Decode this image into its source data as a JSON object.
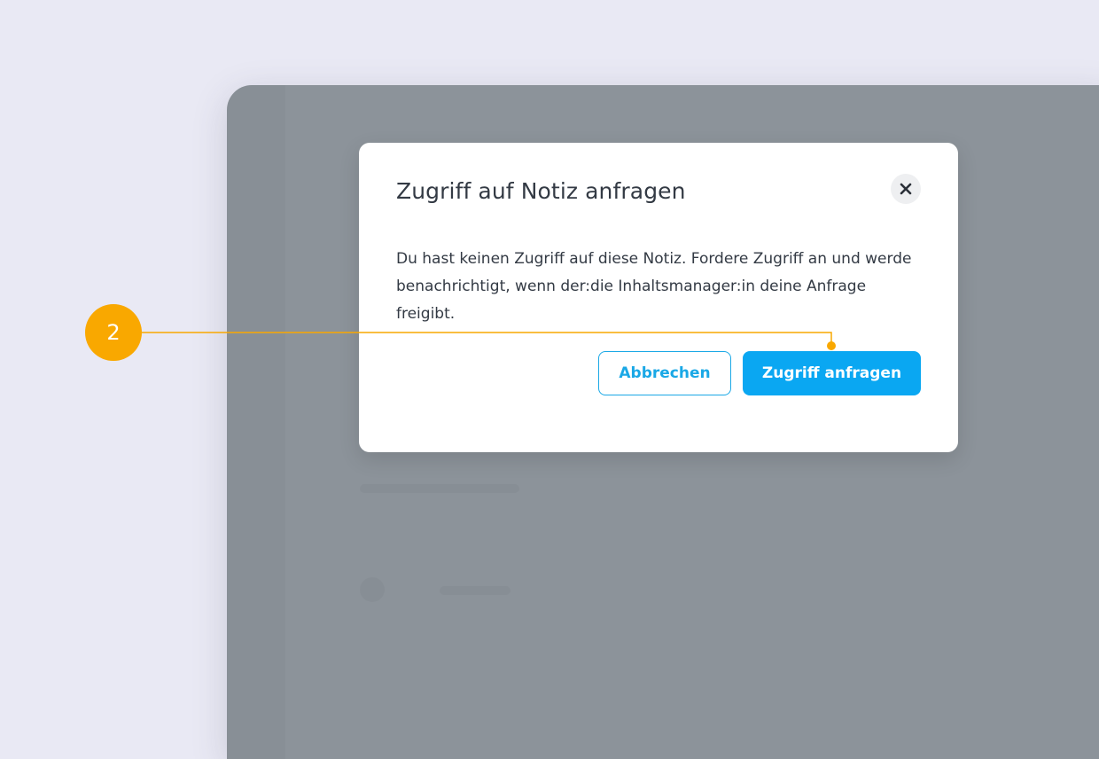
{
  "dialog": {
    "title": "Zugriff auf Notiz anfragen",
    "close_icon": "close-icon",
    "body": "Du hast keinen Zugriff auf diese Notiz. Fordere Zugriff an und werde benachrichtigt, wenn der:die Inhaltsmanager:in deine Anfrage freigibt.",
    "cancel_label": "Abbrechen",
    "request_label": "Zugriff anfragen"
  },
  "callout": {
    "number": "2"
  },
  "colors": {
    "page_background": "#e9e9f4",
    "overlay": "#8c939a",
    "dialog_background": "#ffffff",
    "primary": "#0aa7f2",
    "cancel_border": "#1aa8e6",
    "text": "#333a44",
    "callout": "#f9a800"
  }
}
